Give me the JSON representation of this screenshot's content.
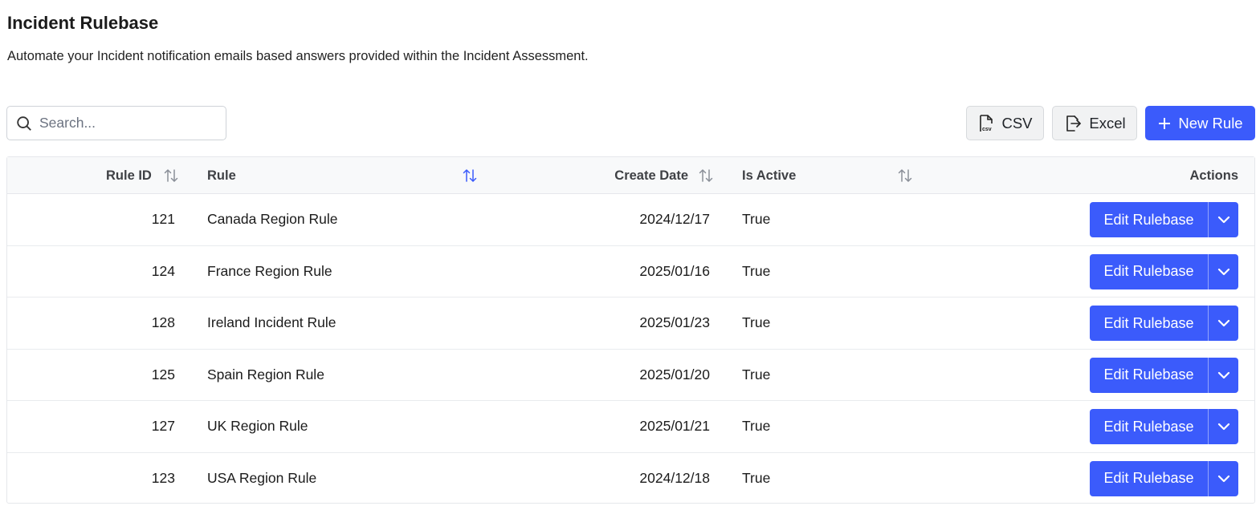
{
  "header": {
    "title": "Incident Rulebase",
    "subtitle": "Automate your Incident notification emails based answers provided within the Incident Assessment."
  },
  "search": {
    "placeholder": "Search...",
    "value": ""
  },
  "toolbar": {
    "csv_label": "CSV",
    "excel_label": "Excel",
    "new_rule_label": "New Rule"
  },
  "table": {
    "columns": {
      "rule_id": "Rule ID",
      "rule": "Rule",
      "create_date": "Create Date",
      "is_active": "Is Active",
      "actions": "Actions"
    },
    "sorted_column": "rule",
    "rows": [
      {
        "rule_id": "121",
        "rule": "Canada Region Rule",
        "create_date": "2024/12/17",
        "is_active": "True",
        "action_label": "Edit Rulebase"
      },
      {
        "rule_id": "124",
        "rule": "France Region Rule",
        "create_date": "2025/01/16",
        "is_active": "True",
        "action_label": "Edit Rulebase"
      },
      {
        "rule_id": "128",
        "rule": "Ireland Incident Rule",
        "create_date": "2025/01/23",
        "is_active": "True",
        "action_label": "Edit Rulebase"
      },
      {
        "rule_id": "125",
        "rule": "Spain Region Rule",
        "create_date": "2025/01/20",
        "is_active": "True",
        "action_label": "Edit Rulebase"
      },
      {
        "rule_id": "127",
        "rule": "UK Region Rule",
        "create_date": "2025/01/21",
        "is_active": "True",
        "action_label": "Edit Rulebase"
      },
      {
        "rule_id": "123",
        "rule": "USA Region Rule",
        "create_date": "2024/12/18",
        "is_active": "True",
        "action_label": "Edit Rulebase"
      }
    ]
  },
  "colors": {
    "accent": "#3b5bfb",
    "sort_active": "#3b5bfb",
    "sort_inactive": "#8a8f98"
  },
  "icons": {
    "search": "search-icon",
    "csv": "csv-file-icon",
    "excel": "export-icon",
    "new": "plus-icon",
    "sort": "sort-icon",
    "caret": "chevron-down-icon"
  }
}
